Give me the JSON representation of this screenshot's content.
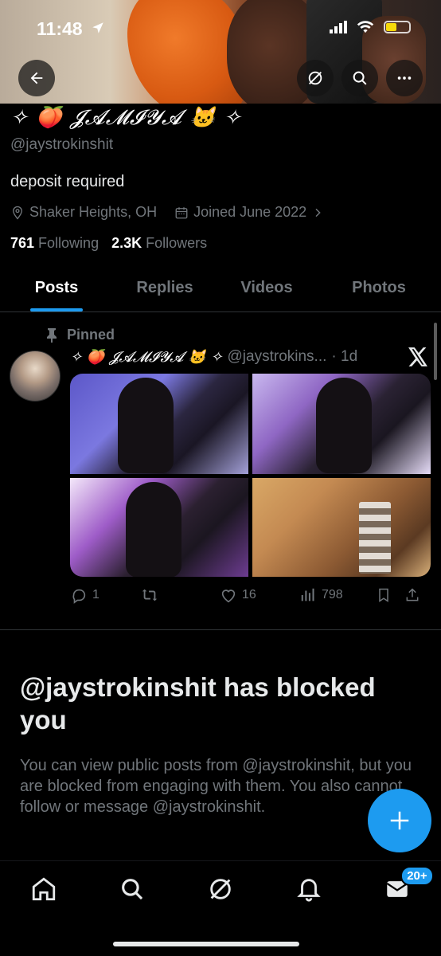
{
  "status_bar": {
    "time": "11:48"
  },
  "profile": {
    "display_name": "✧ 🍑 𝓙𝓐𝓜𝓘𝓨𝓐 🐱 ✧",
    "handle": "@jaystrokinshit",
    "bio": "deposit required",
    "location": "Shaker Heights, OH",
    "joined": "Joined June 2022",
    "following_count": "761",
    "following_label": "Following",
    "followers_count": "2.3K",
    "followers_label": "Followers"
  },
  "tabs": [
    {
      "label": "Posts",
      "active": true
    },
    {
      "label": "Replies"
    },
    {
      "label": "Videos"
    },
    {
      "label": "Photos"
    }
  ],
  "pinned_post": {
    "pinned_label": "Pinned",
    "author_name": "✧ 🍑 𝓙𝓐𝓜𝓘𝓨𝓐 🐱 ✧",
    "author_handle": "@jaystrokins...",
    "time": "· 1d",
    "replies": "1",
    "likes": "16",
    "views": "798"
  },
  "blocked": {
    "title": "@jaystrokinshit has blocked you",
    "description": "You can view public posts from @jaystrokinshit, but you are blocked from engaging with them. You also cannot follow or message @jaystrokinshit."
  },
  "bottom_nav": {
    "messages_badge": "20+"
  },
  "colors": {
    "accent": "#1d9bf0",
    "muted": "#71767b",
    "background": "#000000"
  }
}
